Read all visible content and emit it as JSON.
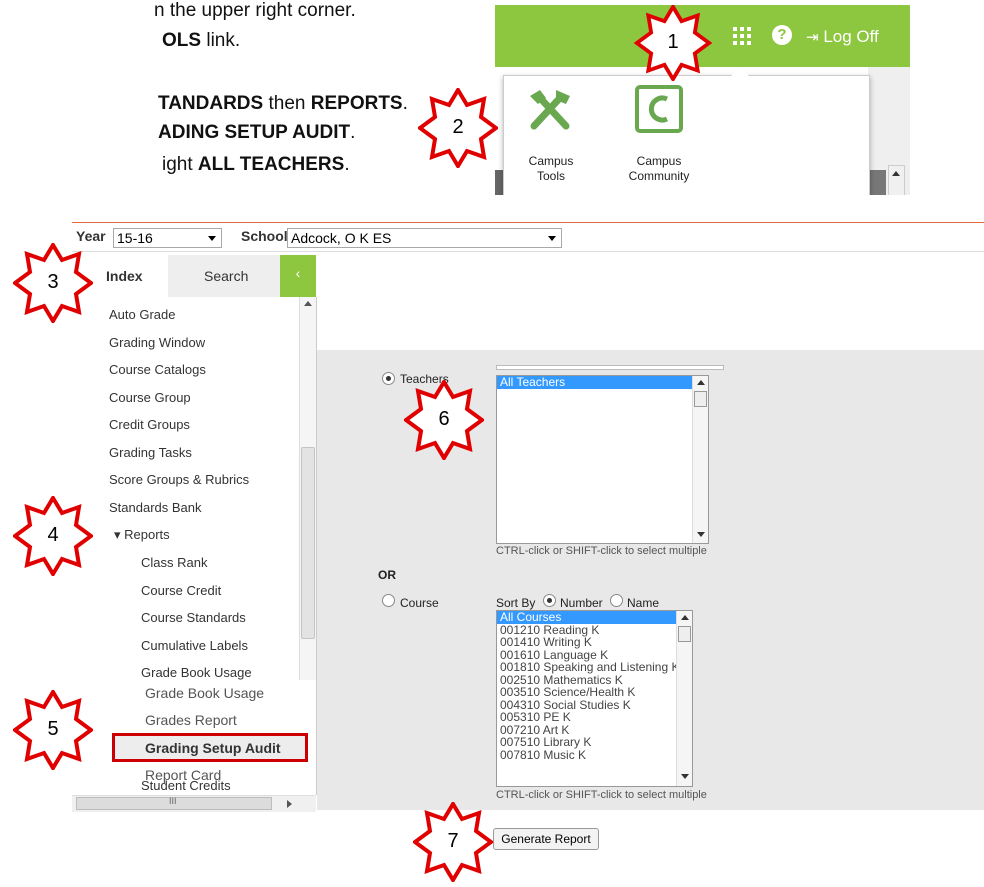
{
  "instructions": {
    "line1": "n the upper right corner.",
    "line2_pre": "",
    "line2_bold": "OLS",
    "line2_post": " link.",
    "line3_bold": "TANDARDS",
    "line3_mid": " then ",
    "line3_bold2": "REPORTS",
    "line3_post": ".",
    "line4_bold": "ADING SETUP AUDIT",
    "line4_post": ".",
    "line5_pre": "ight ",
    "line5_bold": "ALL TEACHERS",
    "line5_post": "."
  },
  "topbar": {
    "logoff_label": "Log Off",
    "help_label": "?",
    "tools": [
      {
        "label": "Campus\nTools",
        "label1": "Campus",
        "label2": "Tools"
      },
      {
        "label": "Campus\nCommunity",
        "label1": "Campus",
        "label2": "Community"
      }
    ]
  },
  "filters": {
    "year_label": "Year",
    "year_value": "15-16",
    "school_label": "School",
    "school_value": "Adcock, O K ES"
  },
  "tabs": {
    "index_label": "Index",
    "search_label": "Search",
    "collapse_label": "‹"
  },
  "sidebar": {
    "items": [
      "Auto Grade",
      "Grading Window",
      "Course Catalogs",
      "Course Group",
      "Credit Groups",
      "Grading Tasks",
      "Score Groups & Rubrics",
      "Standards Bank",
      "▾ Reports",
      "Class Rank",
      "Course Credit",
      "Course Standards",
      "Cumulative Labels",
      "Grade Book Usage"
    ],
    "overlay_items": [
      "Grade Book Usage",
      "Grades Report",
      "Grading Setup Audit",
      "Report Card",
      "Student Credits"
    ],
    "hscroll_grip": "III"
  },
  "form": {
    "teachers_label": "Teachers",
    "teachers_list": [
      "All Teachers"
    ],
    "teachers_hint": "CTRL-click or SHIFT-click to select multiple",
    "or_label": "OR",
    "course_label": "Course",
    "sort_by_label": "Sort By",
    "sort_number_label": "Number",
    "sort_name_label": "Name",
    "courses_list": [
      "All Courses",
      "001210 Reading K",
      "001410 Writing K",
      "001610 Language K",
      "001810 Speaking and Listening K",
      "002510 Mathematics K",
      "003510 Science/Health K",
      "004310 Social Studies K",
      "005310 PE K",
      "007210 Art K",
      "007510 Library K",
      "007810 Music K"
    ],
    "courses_hint": "CTRL-click or SHIFT-click to select multiple",
    "generate_label": "Generate Report"
  },
  "callouts": [
    "1",
    "2",
    "3",
    "4",
    "5",
    "6",
    "7"
  ],
  "colors": {
    "brand_green": "#8dc63f",
    "selection_blue": "#3399ff",
    "callout_red": "#e00000",
    "highlight_red": "#cc0000"
  }
}
